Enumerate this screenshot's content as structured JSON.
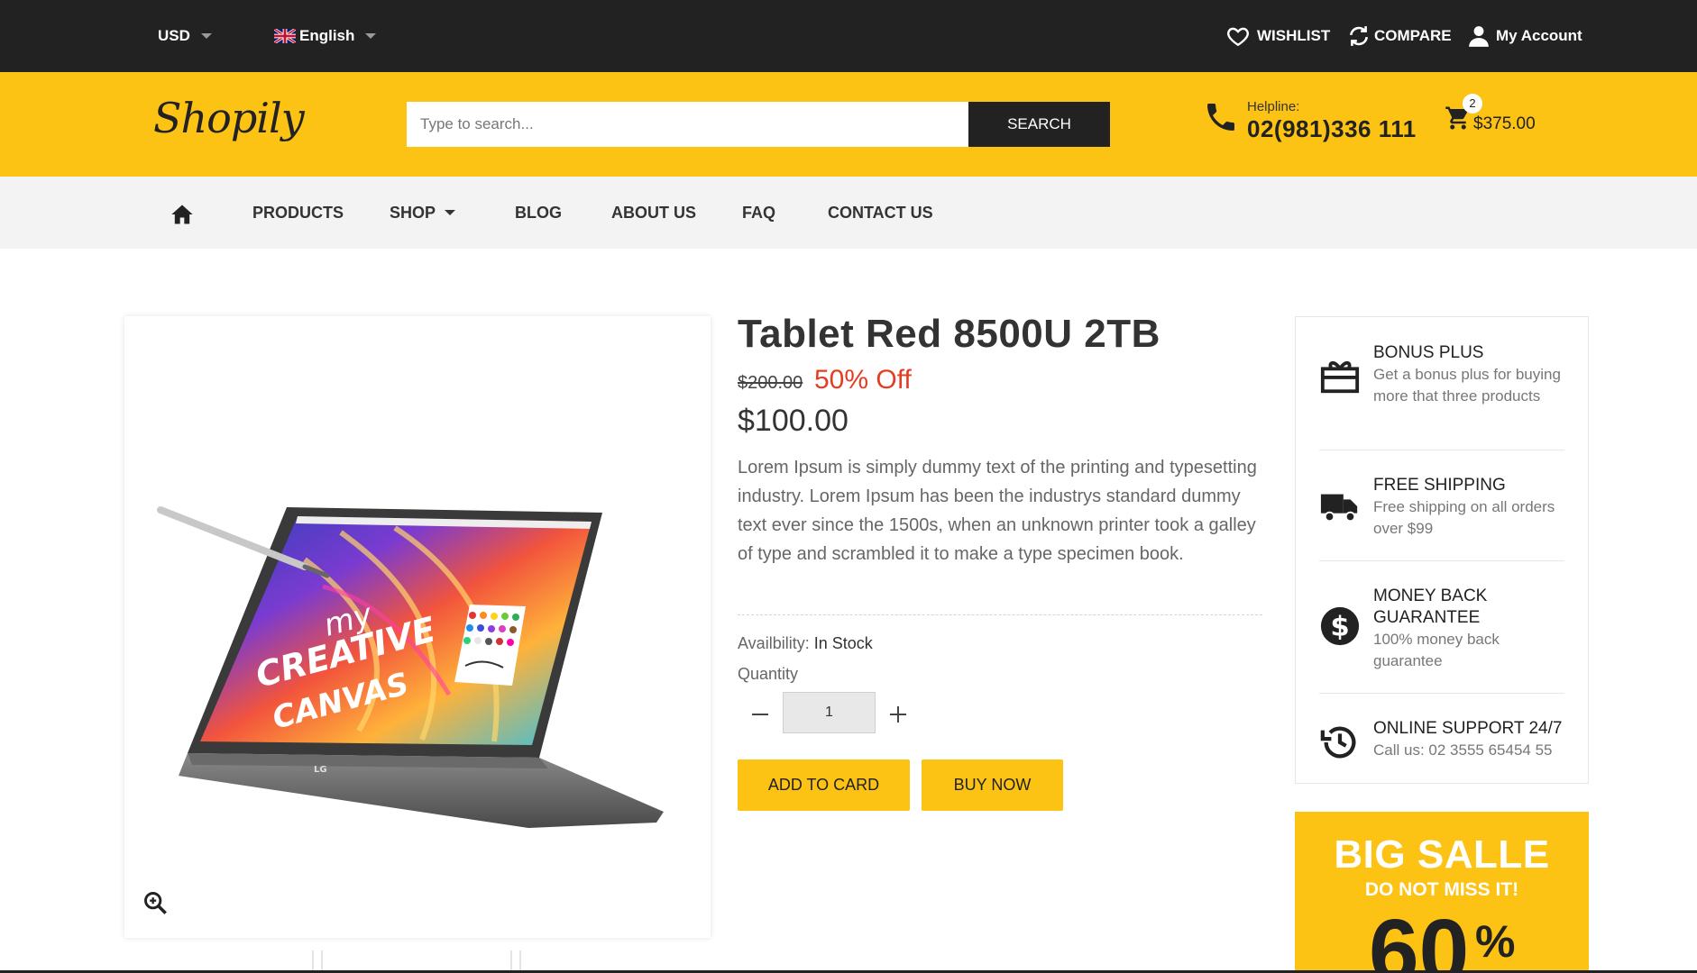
{
  "top_bar": {
    "currency": "USD",
    "language": "English",
    "wishlist": "WISHLIST",
    "compare": "COMPARE",
    "account": "My Account"
  },
  "header": {
    "logo": "Shopily",
    "search_placeholder": "Type to search...",
    "search_button": "SEARCH",
    "helpline_label": "Helpline:",
    "helpline_number": "02(981)336 111",
    "cart_count": "2",
    "cart_total": "$375.00"
  },
  "nav": {
    "items": [
      "PRODUCTS",
      "SHOP",
      "BLOG",
      "ABOUT US",
      "FAQ",
      "CONTACT US"
    ]
  },
  "product": {
    "title": "Tablet Red 8500U 2TB",
    "old_price": "$200.00",
    "discount": "50% Off",
    "price": "$100.00",
    "description": "Lorem Ipsum is simply dummy text of the printing and typesetting industry. Lorem Ipsum has been the industrys standard dummy text ever since the 1500s, when an unknown printer took a galley of type and scrambled it to make a type specimen book.",
    "availability_label": "Availbility:",
    "availability_value": "In Stock",
    "quantity_label": "Quantity",
    "quantity_value": "1",
    "add_button": "ADD TO CARD",
    "buy_button": "BUY NOW",
    "image_text": [
      "my",
      "CREATIVE",
      "CANVAS"
    ],
    "image_brand": "LG"
  },
  "features": [
    {
      "icon": "gift-icon",
      "title": "BONUS PLUS",
      "text": "Get a bonus plus for buying more that three products"
    },
    {
      "icon": "truck-icon",
      "title": "FREE SHIPPING",
      "text": "Free shipping on all orders over $99"
    },
    {
      "icon": "dollar-icon",
      "title": "MONEY BACK GUARANTEE",
      "text": "100% money back guarantee"
    },
    {
      "icon": "history-icon",
      "title": "ONLINE SUPPORT 24/7",
      "text": "Call us: 02 3555 65454 55"
    }
  ],
  "promo": {
    "title": "BIG SALLE",
    "subtitle": "DO NOT MISS IT!",
    "percent": "60",
    "percent_sign": "%"
  },
  "colors": {
    "accent": "#fcc214",
    "dark": "#222222",
    "discount": "#e33e22",
    "nav_bg": "#f3f3f3"
  }
}
